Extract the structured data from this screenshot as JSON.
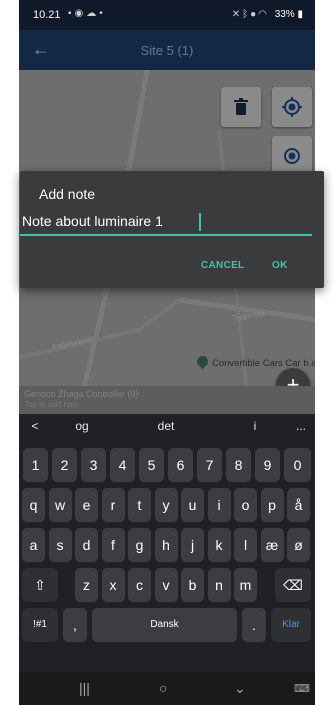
{
  "status_bar": {
    "time": "10.21",
    "left_icons": [
      "image-icon",
      "signal-icon",
      "cloud-icon",
      "dot-icon"
    ],
    "right_icons": [
      "mute-icon",
      "bluetooth-icon",
      "location-icon",
      "wifi-icon"
    ],
    "battery": "33%"
  },
  "app_bar": {
    "back_icon": "arrow-left-icon",
    "title": "Site 5 (1)"
  },
  "map": {
    "streets": [
      "Tryglandet",
      "Regerigdevej"
    ],
    "poi_label": "Convertible Cars Car b.a",
    "buttons": [
      "trash-icon",
      "target-icon",
      "locate-icon"
    ],
    "fab_label": "+"
  },
  "bottom_sheet": {
    "title": "Genoco Zhaga Controller (0)",
    "subtitle": "Tap to add note"
  },
  "dialog": {
    "title": "Add note",
    "input_value": "Note about luminaire 1",
    "cancel_label": "CANCEL",
    "ok_label": "OK"
  },
  "keyboard": {
    "suggestions": [
      "<",
      "og",
      "det",
      "i",
      "..."
    ],
    "row1": [
      "1",
      "2",
      "3",
      "4",
      "5",
      "6",
      "7",
      "8",
      "9",
      "0"
    ],
    "row2": [
      "q",
      "w",
      "e",
      "r",
      "t",
      "y",
      "u",
      "i",
      "o",
      "p",
      "å"
    ],
    "row3": [
      "a",
      "s",
      "d",
      "f",
      "g",
      "h",
      "j",
      "k",
      "l",
      "æ",
      "ø"
    ],
    "row4": [
      "⇧",
      "z",
      "x",
      "c",
      "v",
      "b",
      "n",
      "m",
      "⌫"
    ],
    "row5": {
      "symbols": "!#1",
      "comma": ",",
      "space": "Dansk",
      "period": ".",
      "enter": "Klar"
    }
  },
  "nav_bar": {
    "items": [
      "|||",
      "○",
      "⌄",
      "⌨"
    ]
  },
  "colors": {
    "accent": "#4bbfa5",
    "app_bar": "#122846",
    "dialog_bg": "#3a3b3c",
    "keyboard_bg": "#202124"
  }
}
